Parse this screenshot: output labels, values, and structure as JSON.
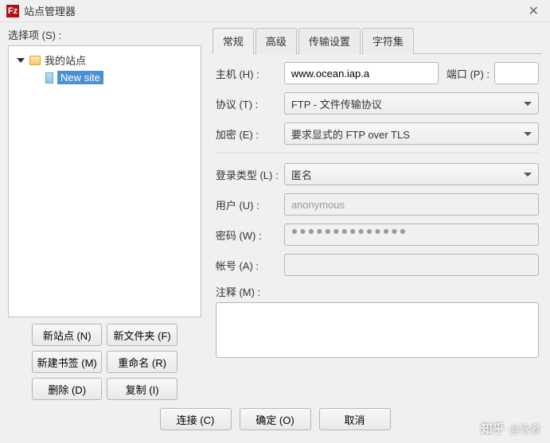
{
  "titlebar": {
    "title": "站点管理器"
  },
  "left": {
    "select_label": "选择项 (S) :",
    "root_label": "我的站点",
    "site_label": "New site",
    "buttons": {
      "new_site": "新站点 (N)",
      "new_folder": "新文件夹 (F)",
      "new_bookmark": "新建书签 (M)",
      "rename": "重命名 (R)",
      "delete": "删除 (D)",
      "copy": "复制 (I)"
    }
  },
  "tabs": {
    "general": "常规",
    "advanced": "高级",
    "transfer": "传输设置",
    "charset": "字符集"
  },
  "form": {
    "host_label": "主机 (H) :",
    "host_value": "www.ocean.iap.a",
    "port_label": "端口 (P) :",
    "port_value": "",
    "protocol_label": "协议 (T) :",
    "protocol_value": "FTP - 文件传输协议",
    "encryption_label": "加密 (E) :",
    "encryption_value": "要求显式的  FTP over TLS",
    "logon_type_label": "登录类型 (L) :",
    "logon_type_value": "匿名",
    "user_label": "用户 (U) :",
    "user_value": "anonymous",
    "password_label": "密码 (W) :",
    "password_mask": "●●●●●●●●●●●●●●",
    "account_label": "帐号 (A) :",
    "account_value": "",
    "comment_label": "注释 (M) :"
  },
  "bottom": {
    "connect": "连接 (C)",
    "ok": "确定 (O)",
    "cancel": "取消"
  },
  "watermark": {
    "logo": "知乎",
    "user": "@泳者"
  }
}
